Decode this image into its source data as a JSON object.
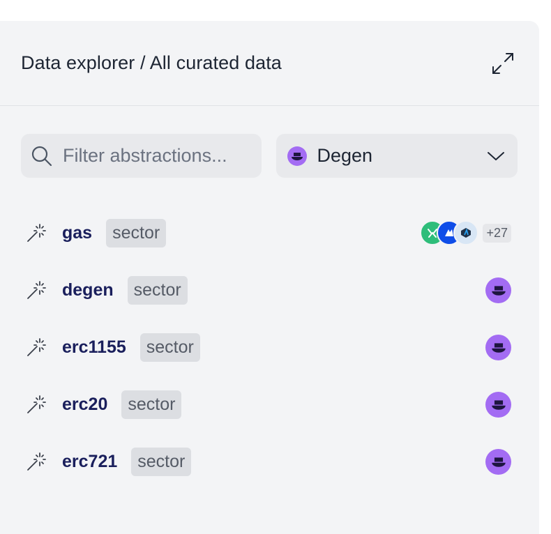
{
  "header": {
    "title": "Data explorer / All curated data"
  },
  "search": {
    "placeholder": "Filter abstractions..."
  },
  "chain_select": {
    "selected": "Degen"
  },
  "rows": [
    {
      "name": "gas",
      "tag": "sector",
      "chains": [
        "gnosis",
        "base",
        "arbitrum"
      ],
      "more": "+27"
    },
    {
      "name": "degen",
      "tag": "sector",
      "chains": [
        "degen"
      ]
    },
    {
      "name": "erc1155",
      "tag": "sector",
      "chains": [
        "degen"
      ]
    },
    {
      "name": "erc20",
      "tag": "sector",
      "chains": [
        "degen"
      ]
    },
    {
      "name": "erc721",
      "tag": "sector",
      "chains": [
        "degen"
      ]
    }
  ],
  "colors": {
    "panel_bg": "#f3f4f6",
    "degen_purple": "#a36cf3",
    "name_text": "#1a1f5c"
  }
}
